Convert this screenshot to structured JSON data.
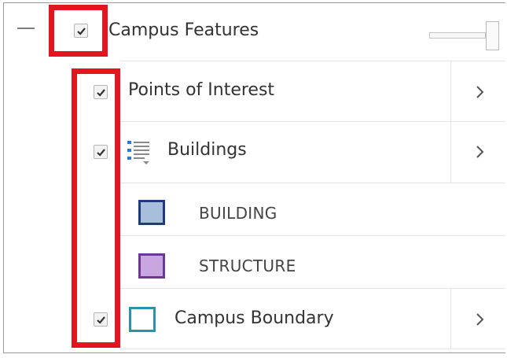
{
  "layer_list": {
    "group": {
      "label": "Campus Features",
      "checked": true
    },
    "layers": [
      {
        "label": "Points of Interest",
        "checked": true
      },
      {
        "label": "Buildings",
        "checked": true,
        "icon": "legend-list-icon"
      },
      {
        "label": "Campus Boundary",
        "checked": true
      }
    ],
    "legend": [
      {
        "label": "BUILDING",
        "fill": "#a7bfdc",
        "stroke": "#1f3b7a"
      },
      {
        "label": "STRUCTURE",
        "fill": "#c9a6df",
        "stroke": "#6a3a8c"
      }
    ],
    "boundary_symbol": {
      "fill": "#ffffff",
      "stroke": "#2f8fb0"
    },
    "annotation_color": "#e3151f"
  }
}
